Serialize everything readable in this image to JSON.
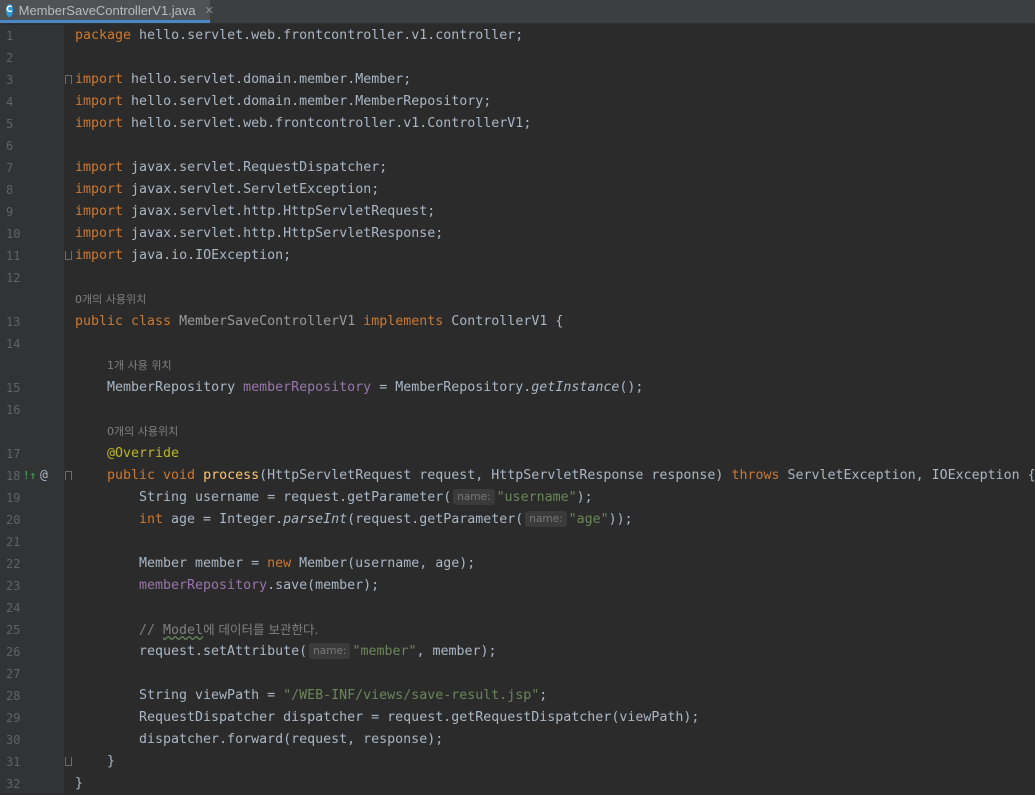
{
  "tab": {
    "icon": "C",
    "filename": "MemberSaveControllerV1.java",
    "close": "✕"
  },
  "gutter": {
    "override_marker": "!↑",
    "annotation_marker": "@"
  },
  "hints": {
    "class_usage": "0개의 사용위치",
    "field_usage": "1개 사용 위치",
    "method_usage": "0개의 사용위치"
  },
  "inlay": {
    "name": "name:"
  },
  "lines": {
    "l1": {
      "kw": "package",
      "rest": " hello.servlet.web.frontcontroller.v1.controller;"
    },
    "l3": {
      "kw": "import",
      "rest": " hello.servlet.domain.member.Member;"
    },
    "l4": {
      "kw": "import",
      "rest": " hello.servlet.domain.member.MemberRepository;"
    },
    "l5": {
      "kw": "import",
      "rest": " hello.servlet.web.frontcontroller.v1.ControllerV1;"
    },
    "l7": {
      "kw": "import",
      "rest": " javax.servlet.RequestDispatcher;"
    },
    "l8": {
      "kw": "import",
      "rest": " javax.servlet.ServletException;"
    },
    "l9": {
      "kw": "import",
      "rest": " javax.servlet.http.HttpServletRequest;"
    },
    "l10": {
      "kw": "import",
      "rest": " javax.servlet.http.HttpServletResponse;"
    },
    "l11": {
      "kw": "import",
      "rest": " java.io.IOException;"
    },
    "l13": {
      "kw1": "public class ",
      "name": "MemberSaveControllerV1",
      "kw2": " implements",
      "rest": " ControllerV1 {"
    },
    "l15": {
      "type": "MemberRepository ",
      "field": "memberRepository",
      "mid": " = MemberRepository.",
      "call": "getInstance",
      "end": "();"
    },
    "l17": {
      "ann": "@Override"
    },
    "l18": {
      "kw": "public void ",
      "fn": "process",
      "params": "(HttpServletRequest request, HttpServletResponse response) ",
      "throws": "throws",
      "rest": " ServletException, IOException {"
    },
    "l19": {
      "pre": "String username = request.getParameter(",
      "str": "\"username\"",
      "end": ");"
    },
    "l20": {
      "kw": "int",
      "mid": " age = Integer.",
      "call": "parseInt",
      "pre": "(request.getParameter(",
      "str": "\"age\"",
      "end": "));"
    },
    "l22": {
      "pre": "Member member = ",
      "kw": "new",
      "rest": " Member(username, age);"
    },
    "l23": {
      "field": "memberRepository",
      "rest": ".save(member);"
    },
    "l25": {
      "c1": "// ",
      "c2": "Model",
      "c3": "에 데이터를 보관한다."
    },
    "l26": {
      "pre": "request.setAttribute(",
      "str": "\"member\"",
      "end": ", member);"
    },
    "l28": {
      "pre": "String viewPath = ",
      "str": "\"/WEB-INF/views/save-result.jsp\"",
      "end": ";"
    },
    "l29": {
      "text": "RequestDispatcher dispatcher = request.getRequestDispatcher(viewPath);"
    },
    "l30": {
      "text": "dispatcher.forward(request, response);"
    },
    "l31": {
      "text": "}"
    },
    "l32": {
      "text": "}"
    }
  },
  "line_numbers": [
    "1",
    "2",
    "3",
    "4",
    "5",
    "6",
    "7",
    "8",
    "9",
    "10",
    "11",
    "12",
    "13",
    "14",
    "15",
    "16",
    "17",
    "18",
    "19",
    "20",
    "21",
    "22",
    "23",
    "24",
    "25",
    "26",
    "27",
    "28",
    "29",
    "30",
    "31",
    "32"
  ]
}
